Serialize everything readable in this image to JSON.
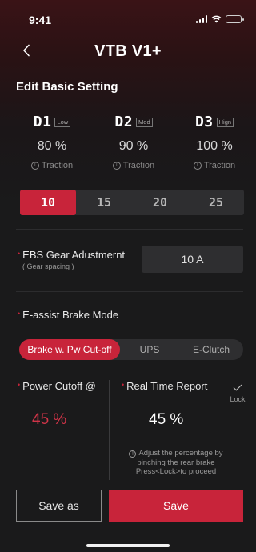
{
  "status_bar": {
    "time": "9:41"
  },
  "header": {
    "title": "VTB V1+"
  },
  "basic_setting": {
    "title": "Edit Basic Setting",
    "gears": [
      {
        "name": "D1",
        "level": "Low",
        "percent": "80 %",
        "traction": "Traction"
      },
      {
        "name": "D2",
        "level": "Med",
        "percent": "90 %",
        "traction": "Traction"
      },
      {
        "name": "D3",
        "level": "Hign",
        "percent": "100 %",
        "traction": "Traction"
      }
    ],
    "options": [
      "10",
      "15",
      "20",
      "25"
    ],
    "selected_option": "10"
  },
  "ebs": {
    "label": "EBS  Gear Adustmernt",
    "sub_label": "( Gear spacing )",
    "value": "10 A"
  },
  "eassist": {
    "label": "E-assist Brake Mode",
    "modes": [
      "Brake w. Pw Cut-off",
      "UPS",
      "E-Clutch"
    ],
    "selected_mode": "Brake w. Pw Cut-off"
  },
  "power_cutoff": {
    "label": "Power Cutoff @",
    "value": "45 %"
  },
  "real_time": {
    "label": "Real Time Report",
    "value": "45 %",
    "lock_label": "Lock",
    "hint": "Adjust the percentage by pinching the rear brake Press<Lock>to proceed"
  },
  "actions": {
    "save_as": "Save as",
    "save": "Save"
  },
  "colors": {
    "accent": "#c8243a",
    "background": "#1a1a1b",
    "field": "#2e2e30"
  }
}
